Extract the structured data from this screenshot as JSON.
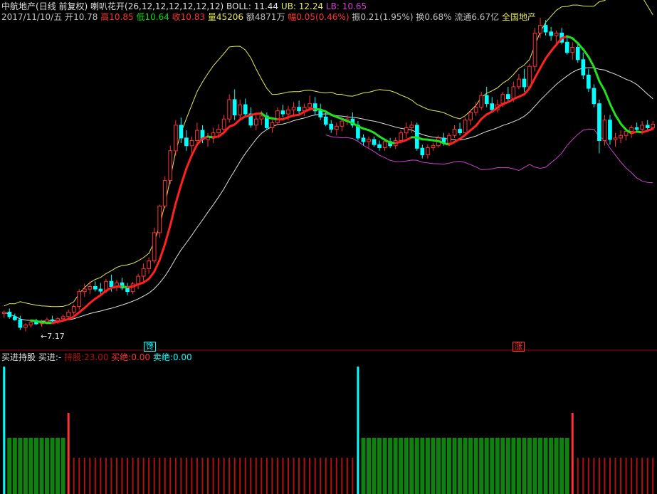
{
  "header": {
    "stock": "中航地产",
    "period": "(日线 前复权)",
    "indicator": "喇叭花开",
    "params": "(26,12,12,12,12,12,12)",
    "boll_label": "BOLL: 11.44",
    "ub_label": "UB: 12.24",
    "lb_label": "LB: 10.65"
  },
  "quote": {
    "date": "2017/11/10/五",
    "open_label": "开",
    "open": "10.78",
    "high_label": "高",
    "high": "10.85",
    "low_label": "低",
    "low": "10.64",
    "close_label": "收",
    "close": "10.83",
    "vol_label": "量",
    "vol": "45206",
    "amt_label": "额",
    "amt": "4871万",
    "chg_label": "幅",
    "chg": "0.05(0.46%)",
    "amp_label": "振",
    "amp": "0.21(1.95%)",
    "turn_label": "换",
    "turn": "0.68%",
    "float_label": "流通",
    "float": "6.67亿",
    "board": "全国地产"
  },
  "lower": {
    "name": "买进持股",
    "buy_label": "买进:",
    "buy": "-",
    "hold_label": "持股:",
    "hold": "23.00",
    "buyend_label": "买绝:",
    "buyend": "0.00",
    "sellend_label": "卖绝:",
    "sellend": "0.00"
  },
  "markers": {
    "low_price": "7.17",
    "tag1": "馋",
    "tag2": "涨"
  },
  "colors": {
    "up": "#ff3333",
    "down": "#00ffff",
    "boll_upper": "#e8e85a",
    "boll_mid": "#e0e0e0",
    "lower_line": "#d040d0",
    "ma_up": "#ff2020",
    "ma_down": "#20e020",
    "hold_bar": "#108010",
    "wait_bar": "#b01010",
    "signal": "#00ffff"
  },
  "chart_data": {
    "type": "candlestick",
    "price_range": [
      7.0,
      13.2
    ],
    "candles": [
      [
        7.52,
        7.58,
        7.44,
        7.55
      ],
      [
        7.55,
        7.62,
        7.42,
        7.46
      ],
      [
        7.46,
        7.52,
        7.38,
        7.4
      ],
      [
        7.4,
        7.48,
        7.2,
        7.25
      ],
      [
        7.25,
        7.33,
        7.17,
        7.3
      ],
      [
        7.3,
        7.38,
        7.25,
        7.35
      ],
      [
        7.35,
        7.42,
        7.3,
        7.32
      ],
      [
        7.32,
        7.4,
        7.26,
        7.36
      ],
      [
        7.36,
        7.44,
        7.3,
        7.4
      ],
      [
        7.4,
        7.48,
        7.34,
        7.38
      ],
      [
        7.38,
        7.45,
        7.32,
        7.42
      ],
      [
        7.42,
        7.5,
        7.36,
        7.46
      ],
      [
        7.46,
        7.6,
        7.4,
        7.55
      ],
      [
        7.55,
        7.7,
        7.5,
        7.66
      ],
      [
        7.66,
        8.0,
        7.6,
        7.95
      ],
      [
        7.95,
        8.1,
        7.85,
        8.0
      ],
      [
        8.0,
        8.15,
        7.9,
        8.05
      ],
      [
        8.05,
        8.15,
        7.95,
        8.0
      ],
      [
        8.0,
        8.12,
        7.9,
        7.96
      ],
      [
        7.96,
        8.2,
        7.92,
        8.15
      ],
      [
        8.15,
        8.28,
        7.95,
        8.05
      ],
      [
        8.05,
        8.18,
        7.96,
        8.12
      ],
      [
        8.12,
        8.22,
        7.98,
        8.02
      ],
      [
        8.02,
        8.12,
        7.88,
        7.95
      ],
      [
        7.95,
        8.14,
        7.9,
        8.1
      ],
      [
        8.1,
        8.3,
        8.0,
        8.25
      ],
      [
        8.25,
        8.5,
        8.15,
        8.4
      ],
      [
        8.4,
        8.62,
        8.3,
        8.55
      ],
      [
        8.55,
        9.2,
        8.5,
        9.1
      ],
      [
        9.1,
        9.65,
        9.0,
        9.62
      ],
      [
        9.62,
        10.2,
        9.58,
        10.12
      ],
      [
        10.12,
        10.8,
        10.05,
        10.7
      ],
      [
        10.7,
        11.3,
        10.6,
        11.2
      ],
      [
        11.2,
        11.35,
        10.85,
        10.95
      ],
      [
        10.95,
        11.1,
        10.7,
        10.8
      ],
      [
        10.8,
        10.98,
        10.66,
        10.9
      ],
      [
        10.9,
        11.25,
        10.8,
        11.1
      ],
      [
        11.1,
        11.2,
        10.85,
        10.92
      ],
      [
        10.92,
        11.05,
        10.78,
        10.98
      ],
      [
        10.98,
        11.15,
        10.85,
        11.05
      ],
      [
        11.05,
        11.22,
        10.95,
        11.12
      ],
      [
        11.12,
        11.4,
        11.05,
        11.32
      ],
      [
        11.32,
        11.8,
        11.25,
        11.7
      ],
      [
        11.7,
        11.9,
        11.3,
        11.4
      ],
      [
        11.4,
        11.7,
        11.3,
        11.6
      ],
      [
        11.6,
        11.72,
        11.35,
        11.42
      ],
      [
        11.42,
        11.55,
        11.15,
        11.2
      ],
      [
        11.2,
        11.4,
        11.1,
        11.32
      ],
      [
        11.32,
        11.48,
        11.2,
        11.38
      ],
      [
        11.38,
        11.45,
        11.1,
        11.15
      ],
      [
        11.15,
        11.3,
        11.05,
        11.25
      ],
      [
        11.25,
        11.55,
        11.2,
        11.48
      ],
      [
        11.48,
        11.6,
        11.35,
        11.42
      ],
      [
        11.42,
        11.58,
        11.3,
        11.5
      ],
      [
        11.5,
        11.65,
        11.4,
        11.55
      ],
      [
        11.55,
        11.68,
        11.4,
        11.48
      ],
      [
        11.48,
        11.62,
        11.38,
        11.55
      ],
      [
        11.55,
        11.78,
        11.48,
        11.62
      ],
      [
        11.62,
        11.75,
        11.4,
        11.48
      ],
      [
        11.48,
        11.62,
        11.3,
        11.36
      ],
      [
        11.36,
        11.45,
        11.18,
        11.22
      ],
      [
        11.22,
        11.3,
        11.05,
        11.12
      ],
      [
        11.12,
        11.25,
        11.0,
        11.18
      ],
      [
        11.18,
        11.35,
        11.08,
        11.28
      ],
      [
        11.28,
        11.4,
        11.2,
        11.32
      ],
      [
        11.32,
        11.45,
        11.15,
        11.2
      ],
      [
        11.2,
        11.28,
        10.9,
        10.95
      ],
      [
        10.95,
        11.02,
        10.8,
        10.88
      ],
      [
        10.88,
        10.98,
        10.76,
        10.92
      ],
      [
        10.92,
        10.98,
        10.78,
        10.82
      ],
      [
        10.82,
        10.9,
        10.7,
        10.76
      ],
      [
        10.76,
        10.92,
        10.7,
        10.88
      ],
      [
        10.88,
        10.95,
        10.75,
        10.8
      ],
      [
        10.8,
        10.96,
        10.74,
        10.9
      ],
      [
        10.9,
        11.1,
        10.84,
        11.05
      ],
      [
        11.05,
        11.25,
        10.95,
        11.15
      ],
      [
        11.15,
        11.28,
        11.05,
        11.2
      ],
      [
        11.2,
        11.25,
        10.7,
        10.75
      ],
      [
        10.75,
        10.82,
        10.55,
        10.62
      ],
      [
        10.62,
        10.82,
        10.55,
        10.76
      ],
      [
        10.76,
        10.85,
        10.7,
        10.8
      ],
      [
        10.8,
        11.0,
        10.76,
        10.95
      ],
      [
        10.95,
        11.05,
        10.8,
        10.85
      ],
      [
        10.85,
        11.05,
        10.8,
        11.0
      ],
      [
        11.0,
        11.2,
        10.95,
        11.12
      ],
      [
        11.12,
        11.25,
        11.0,
        11.05
      ],
      [
        11.05,
        11.35,
        11.0,
        11.3
      ],
      [
        11.3,
        11.5,
        11.2,
        11.45
      ],
      [
        11.45,
        11.65,
        11.38,
        11.55
      ],
      [
        11.55,
        11.85,
        11.5,
        11.78
      ],
      [
        11.78,
        11.95,
        11.55,
        11.62
      ],
      [
        11.62,
        11.75,
        11.45,
        11.5
      ],
      [
        11.5,
        11.7,
        11.45,
        11.6
      ],
      [
        11.6,
        11.85,
        11.55,
        11.8
      ],
      [
        11.8,
        11.95,
        11.65,
        11.72
      ],
      [
        11.72,
        12.05,
        11.65,
        11.95
      ],
      [
        11.95,
        12.2,
        11.9,
        12.1
      ],
      [
        12.1,
        12.3,
        11.85,
        11.95
      ],
      [
        11.95,
        12.4,
        11.9,
        12.35
      ],
      [
        12.35,
        13.1,
        12.25,
        13.0
      ],
      [
        13.0,
        13.3,
        12.9,
        13.15
      ],
      [
        13.15,
        13.25,
        12.95,
        13.02
      ],
      [
        13.02,
        13.12,
        12.85,
        12.95
      ],
      [
        12.95,
        13.05,
        12.8,
        13.0
      ],
      [
        13.0,
        13.1,
        12.78,
        12.82
      ],
      [
        12.82,
        12.92,
        12.58,
        12.62
      ],
      [
        12.62,
        12.82,
        12.48,
        12.72
      ],
      [
        12.72,
        12.8,
        12.42,
        12.48
      ],
      [
        12.48,
        12.62,
        12.1,
        12.18
      ],
      [
        12.18,
        12.3,
        11.85,
        11.92
      ],
      [
        11.92,
        12.0,
        11.55,
        11.62
      ],
      [
        11.62,
        11.7,
        10.65,
        10.9
      ],
      [
        10.9,
        11.4,
        10.8,
        11.3
      ],
      [
        11.3,
        11.4,
        10.82,
        10.92
      ],
      [
        10.92,
        11.05,
        10.78,
        10.95
      ],
      [
        10.95,
        11.1,
        10.85,
        11.0
      ],
      [
        11.0,
        11.15,
        10.9,
        11.08
      ],
      [
        11.08,
        11.2,
        10.95,
        11.15
      ],
      [
        11.15,
        11.25,
        11.05,
        11.12
      ],
      [
        11.12,
        11.28,
        11.02,
        11.2
      ],
      [
        11.2,
        11.3,
        11.08,
        11.15
      ],
      [
        11.15,
        11.28,
        11.1,
        11.22
      ]
    ]
  }
}
